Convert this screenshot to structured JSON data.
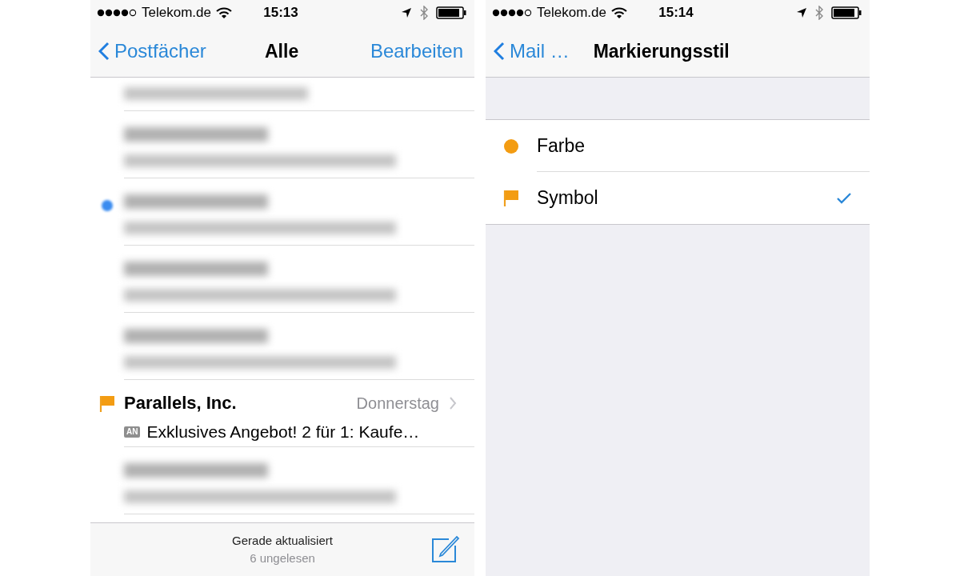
{
  "left_screen": {
    "status_bar": {
      "carrier": "Telekom.de",
      "time": "15:13"
    },
    "nav_bar": {
      "back": "Postfächer",
      "title": "Alle",
      "action": "Bearbeiten"
    },
    "messages": [
      {
        "kind": "clipped",
        "unread": false,
        "flagged": false
      },
      {
        "kind": "blurred",
        "unread": false,
        "flagged": false
      },
      {
        "kind": "blurred",
        "unread": true,
        "flagged": false
      },
      {
        "kind": "blurred",
        "unread": false,
        "flagged": false
      },
      {
        "kind": "blurred",
        "unread": false,
        "flagged": false
      },
      {
        "kind": "message",
        "unread": false,
        "flagged": true,
        "sender": "Parallels, Inc.",
        "date": "Donnerstag",
        "badge": "AN",
        "preview": "Exklusives Angebot! 2 für 1: Kaufe…"
      },
      {
        "kind": "blurred",
        "unread": false,
        "flagged": false
      }
    ],
    "toolbar": {
      "status": "Gerade aktualisiert",
      "count": "6 ungelesen"
    }
  },
  "right_screen": {
    "status_bar": {
      "carrier": "Telekom.de",
      "time": "15:14"
    },
    "nav_bar": {
      "back": "Mail …",
      "title": "Markierungsstil"
    },
    "options": [
      {
        "kind": "dot",
        "label": "Farbe",
        "selected": false
      },
      {
        "kind": "flag",
        "label": "Symbol",
        "selected": true
      }
    ]
  }
}
